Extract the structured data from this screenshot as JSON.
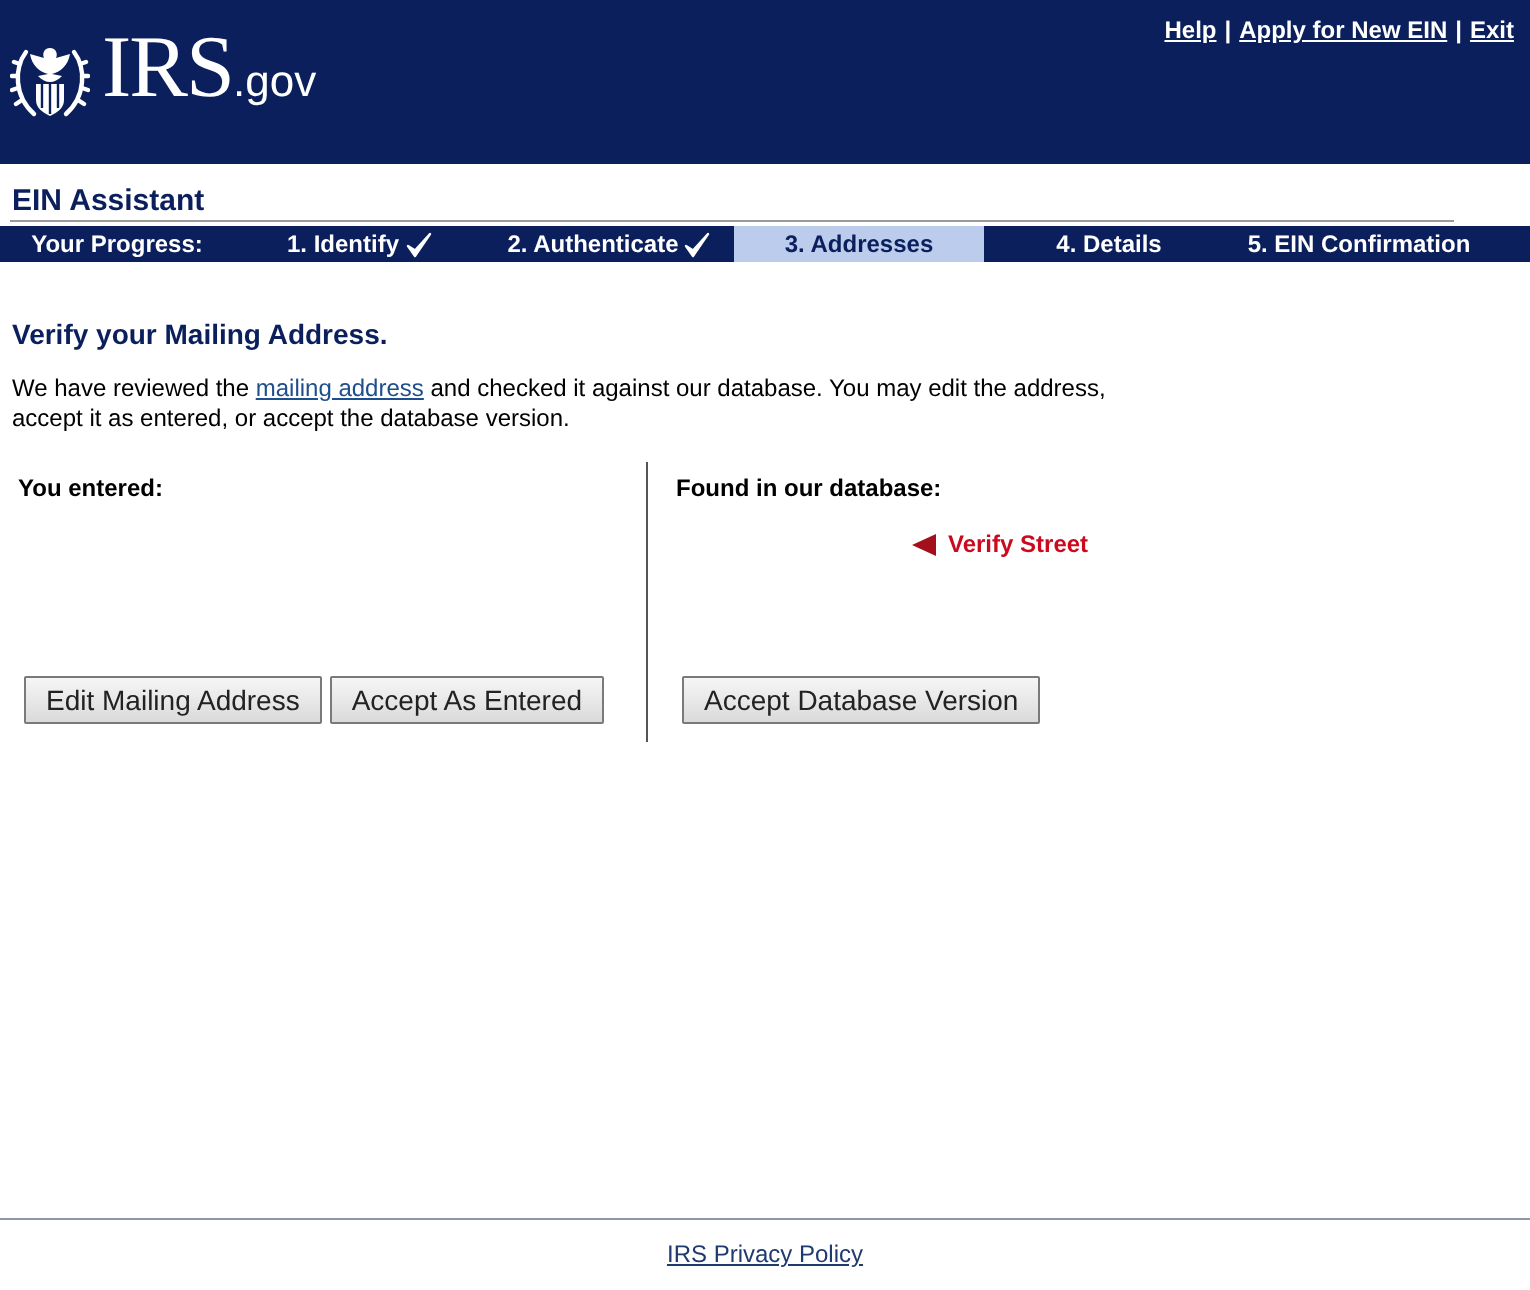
{
  "header": {
    "logo": {
      "wordmark": "IRS",
      "suffix": ".gov"
    },
    "top_nav": [
      {
        "kind": "link",
        "text": "Help"
      },
      {
        "kind": "separator",
        "text": "|"
      },
      {
        "kind": "link",
        "text": "Apply for New EIN"
      },
      {
        "kind": "separator",
        "text": "|"
      },
      {
        "kind": "link",
        "text": "Exit"
      }
    ]
  },
  "app_title": "EIN Assistant",
  "progress": {
    "label": "Your Progress:",
    "steps": [
      {
        "label": "1. Identify",
        "completed": true,
        "selected": false
      },
      {
        "label": "2. Authenticate",
        "completed": true,
        "selected": false
      },
      {
        "label": "3. Addresses",
        "completed": false,
        "selected": true
      },
      {
        "label": "4. Details",
        "completed": false,
        "selected": false
      },
      {
        "label": "5. EIN Confirmation",
        "completed": false,
        "selected": false
      }
    ]
  },
  "section_title": "Verify your Mailing Address.",
  "intro": {
    "before": "We have reviewed the ",
    "link": "mailing address",
    "after": " and checked it against our database. You may edit the address, accept it as entered, or accept the database version."
  },
  "columns": [
    {
      "heading": "You entered:",
      "buttons": [
        "Edit Mailing Address",
        "Accept As Entered"
      ]
    },
    {
      "heading": "Found in our database:",
      "warning": "Verify Street",
      "buttons": [
        "Accept Database Version"
      ]
    }
  ],
  "footer": {
    "link": "IRS Privacy Policy"
  }
}
